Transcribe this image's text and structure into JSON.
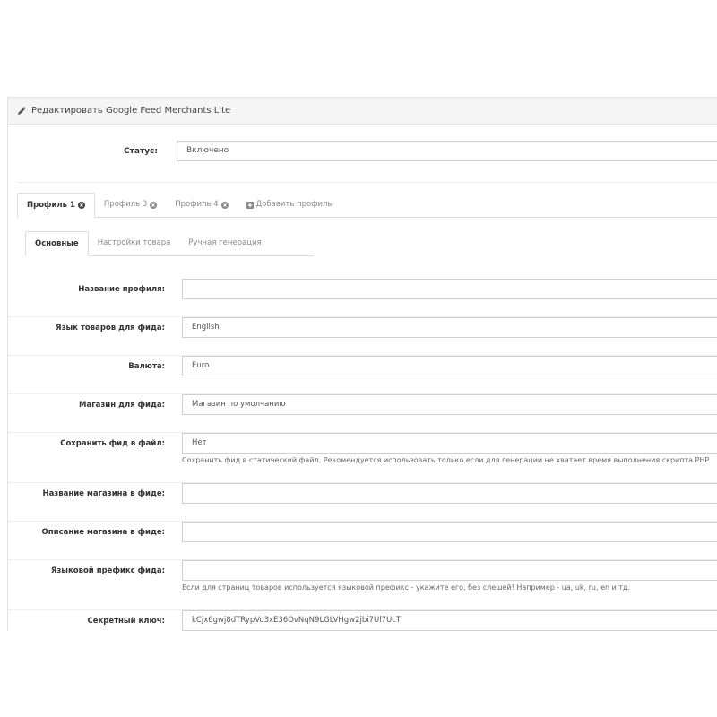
{
  "panel": {
    "title": "Редактировать Google Feed Merchants Lite",
    "title_icon": "pencil-icon"
  },
  "status": {
    "label": "Статус:",
    "value": "Включено"
  },
  "profile_tabs": [
    {
      "label": "Профиль 1",
      "active": true,
      "icon": "close-circle-icon"
    },
    {
      "label": "Профиль 3",
      "active": false,
      "icon": "close-circle-icon"
    },
    {
      "label": "Профиль 4",
      "active": false,
      "icon": "close-circle-icon"
    },
    {
      "label": "Добавить профиль",
      "active": false,
      "icon": "plus-square-icon"
    }
  ],
  "section_tabs": [
    {
      "label": "Основные",
      "active": true
    },
    {
      "label": "Настройки товара",
      "active": false
    },
    {
      "label": "Ручная генерация",
      "active": false
    }
  ],
  "fields": [
    {
      "label": "Название профиля:",
      "value": "",
      "help": ""
    },
    {
      "label": "Язык товаров для фида:",
      "value": "English",
      "help": ""
    },
    {
      "label": "Валюта:",
      "value": "Euro",
      "help": ""
    },
    {
      "label": "Магазин для фида:",
      "value": "Магазин по умолчанию",
      "help": ""
    },
    {
      "label": "Сохранить фид в файл:",
      "value": "Нет",
      "help": "Сохранить фид в статический файл. Рекомендуется использовать только если для генерации не хватает время выполнения скрипта PHP."
    },
    {
      "label": "Название магазина в фиде:",
      "value": "",
      "help": ""
    },
    {
      "label": "Описание магазина в фиде:",
      "value": "",
      "help": ""
    },
    {
      "label": "Языковой префикс фида:",
      "value": "",
      "help": "Если для страниц товаров используется языковой префикс - укажите его, без слешей! Например - ua, uk, ru, en и тд."
    },
    {
      "label": "Секретный ключ:",
      "value": "kCjx6gwj8dTRypVo3xE36OvNqN9LGLVHgw2jbi7Ul7UcT",
      "help": ""
    }
  ]
}
